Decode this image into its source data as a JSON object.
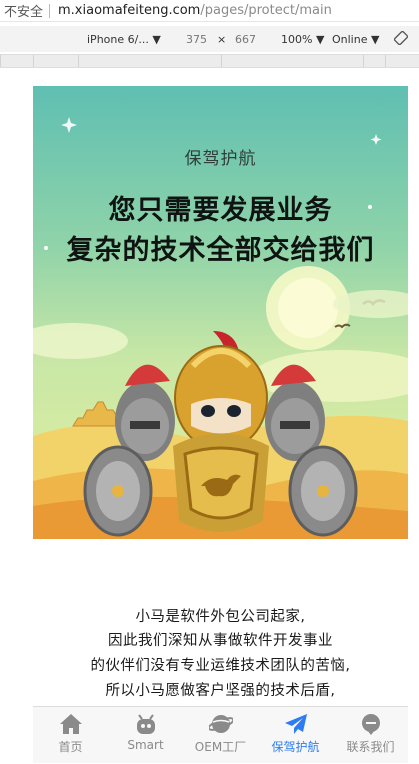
{
  "browser": {
    "insecure_label": "不安全",
    "url_domain": "m.xiaomafeiteng.com",
    "url_path": "/pages/protect/main"
  },
  "device_toolbar": {
    "device": "iPhone 6/... ▼",
    "width": "375",
    "times": "×",
    "height": "667",
    "zoom": "100% ▼",
    "network": "Online ▼"
  },
  "hero": {
    "subtitle": "保驾护航",
    "headline_line1": "您只需要发展业务",
    "headline_line2": "复杂的技术全部交给我们"
  },
  "intro": {
    "lines": [
      "小马是软件外包公司起家,",
      "因此我们深知从事做软件开发事业",
      "的伙伴们没有专业运维技术团队的苦恼,",
      "所以小马愿做客户坚强的技术后盾,"
    ]
  },
  "tabbar": {
    "tabs": [
      {
        "label": "首页",
        "icon": "home-icon"
      },
      {
        "label": "Smart",
        "icon": "robot-icon"
      },
      {
        "label": "OEM工厂",
        "icon": "planet-icon"
      },
      {
        "label": "保驾护航",
        "icon": "paper-plane-icon"
      },
      {
        "label": "联系我们",
        "icon": "chat-icon"
      }
    ],
    "active_index": 3,
    "active_color": "#2d7cf6",
    "inactive_color": "#8a8a8a"
  }
}
